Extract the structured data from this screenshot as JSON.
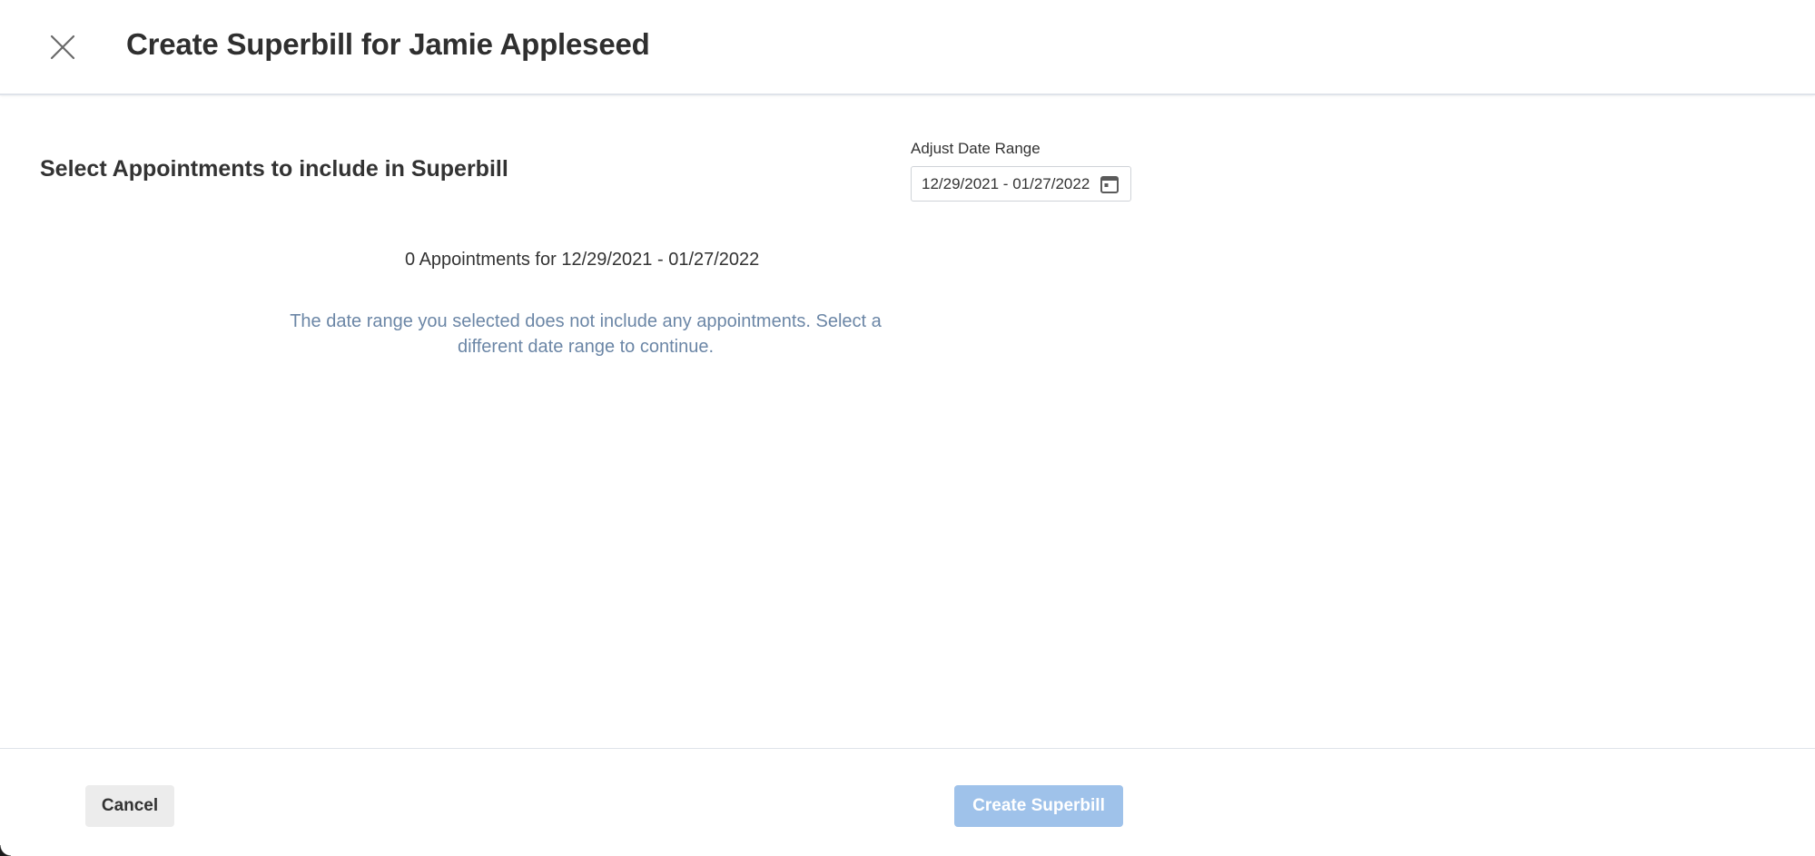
{
  "header": {
    "title": "Create Superbill for Jamie Appleseed",
    "close_icon": "close-icon"
  },
  "section": {
    "heading": "Select Appointments to include in Superbill"
  },
  "date_range": {
    "label": "Adjust Date Range",
    "value": "12/29/2021 - 01/27/2022",
    "icon": "calendar-icon"
  },
  "appointments": {
    "count_text": "0 Appointments for 12/29/2021 - 01/27/2022",
    "empty_message": "The date range you selected does not include any appointments. Select a different date range to continue."
  },
  "footer": {
    "cancel_label": "Cancel",
    "create_label": "Create Superbill",
    "create_disabled": true
  },
  "colors": {
    "primary_disabled": "#9fc2ea",
    "muted_text": "#6b86a6",
    "title_text": "#2f2f2f"
  }
}
